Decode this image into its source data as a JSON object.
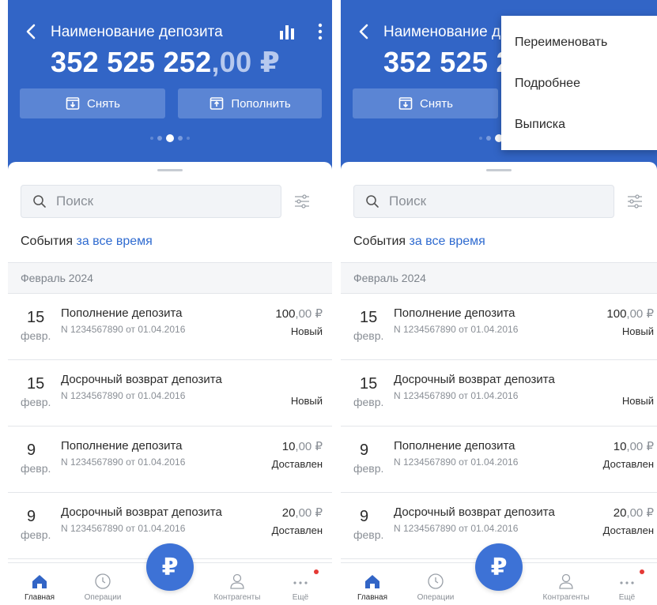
{
  "header": {
    "title": "Наименование депозита",
    "title_truncated": "Наименование деп",
    "amount_main": "352 525 252",
    "amount_cents": ",00 ₽",
    "amount_main_truncated": "352 525 2",
    "withdraw_label": "Снять",
    "topup_label": "Пополнить",
    "carousel_active_index": 2,
    "carousel_count": 5
  },
  "search": {
    "placeholder": "Поиск"
  },
  "events": {
    "label": "События",
    "period": "за все время"
  },
  "month_label": "Февраль 2024",
  "transactions": [
    {
      "day": "15",
      "month": "февр.",
      "title": "Пополнение депозита",
      "doc": "N 1234567890 от 01.04.2016",
      "amount_main": "100",
      "amount_cents": ",00 ₽",
      "status": "Новый"
    },
    {
      "day": "15",
      "month": "февр.",
      "title": "Досрочный возврат депозита",
      "doc": "N 1234567890 от 01.04.2016",
      "amount_main": "",
      "amount_cents": "",
      "status": "Новый"
    },
    {
      "day": "9",
      "month": "февр.",
      "title": "Пополнение депозита",
      "doc": "N 1234567890 от 01.04.2016",
      "amount_main": "10",
      "amount_cents": ",00 ₽",
      "status": "Доставлен"
    },
    {
      "day": "9",
      "month": "февр.",
      "title": "Досрочный возврат депозита",
      "doc": "N 1234567890 от 01.04.2016",
      "amount_main": "20",
      "amount_cents": ",00 ₽",
      "status": "Доставлен"
    }
  ],
  "tabbar": {
    "home": "Главная",
    "operations": "Операции",
    "pay_symbol": "₽",
    "contacts": "Контрагенты",
    "more": "Ещё"
  },
  "menu": {
    "items": [
      "Переименовать",
      "Подробнее",
      "Выписка"
    ]
  },
  "colors": {
    "brand_blue": "#3265c6",
    "link_blue": "#2f6bd0",
    "badge_red": "#e53935"
  }
}
